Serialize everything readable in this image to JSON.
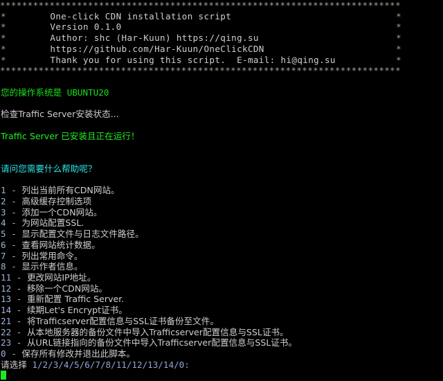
{
  "terminal": {
    "background_color": "#000000",
    "default_text_color": "#d0d0d0",
    "colors": {
      "green": "#18e018",
      "bright_green": "#22ef22",
      "cyan": "#2ee6e6",
      "white": "#cfcfcf",
      "star_border": "#a8a090",
      "menu_number": "#9fb4dc",
      "cursor": "#1ee81e"
    }
  },
  "banner": {
    "border_row": "*************************************************************************",
    "left_mark": "*",
    "right_mark": "*",
    "lines": [
      "One-click CDN installation script",
      "Version 0.1.0",
      "Author: shc (Har-Kuun) https://qing.su",
      "https://github.com/Har-Kuun/OneClickCDN",
      "Thank you for using this script.  E-mail: hi@qing.su"
    ]
  },
  "status": {
    "os_label": "您的操作系统是",
    "os_value": "UBUNTU20",
    "checking_text": "检查Traffic Server安装状态...",
    "installed_text": "Traffic Server 已安装且正在运行！"
  },
  "prompt_heading": "请问您需要什么帮助呢？",
  "menu": {
    "items": [
      {
        "key": "1",
        "dash": "-",
        "label": "列出当前所有CDN网站。"
      },
      {
        "key": "2",
        "dash": "-",
        "label": "高级缓存控制选项"
      },
      {
        "key": "3",
        "dash": "-",
        "label": "添加一个CDN网站。"
      },
      {
        "key": "4",
        "dash": "-",
        "label": "为网站配置SSL."
      },
      {
        "key": "5",
        "dash": "-",
        "label": "显示配置文件与日志文件路径。"
      },
      {
        "key": "6",
        "dash": "-",
        "label": "查看网站统计数据。"
      },
      {
        "key": "7",
        "dash": "-",
        "label": "列出常用命令。"
      },
      {
        "key": "8",
        "dash": "-",
        "label": "显示作者信息。"
      },
      {
        "key": "11",
        "dash": "-",
        "label": "更改网站IP地址。"
      },
      {
        "key": "12",
        "dash": "-",
        "label": "移除一个CDN网站。"
      },
      {
        "key": "13",
        "dash": "-",
        "label": "重新配置 Traffic Server."
      },
      {
        "key": "14",
        "dash": "-",
        "label": "续期Let's Encrypt证书。"
      },
      {
        "key": "21",
        "dash": "-",
        "label": "将Trafficserver配置信息与SSL证书备份至文件。"
      },
      {
        "key": "22",
        "dash": "-",
        "label": "从本地服务器的备份文件中导入Trafficserver配置信息与SSL证书。"
      },
      {
        "key": "23",
        "dash": "-",
        "label": "从URL链接指向的备份文件中导入Trafficserver配置信息与SSL证书。"
      },
      {
        "key": "0",
        "dash": "-",
        "label": "保存所有修改并退出此脚本。"
      }
    ]
  },
  "input_prompt": {
    "label": "请选择",
    "options": "1/2/3/4/5/6/7/8/11/12/13/14/0:",
    "value": ""
  }
}
